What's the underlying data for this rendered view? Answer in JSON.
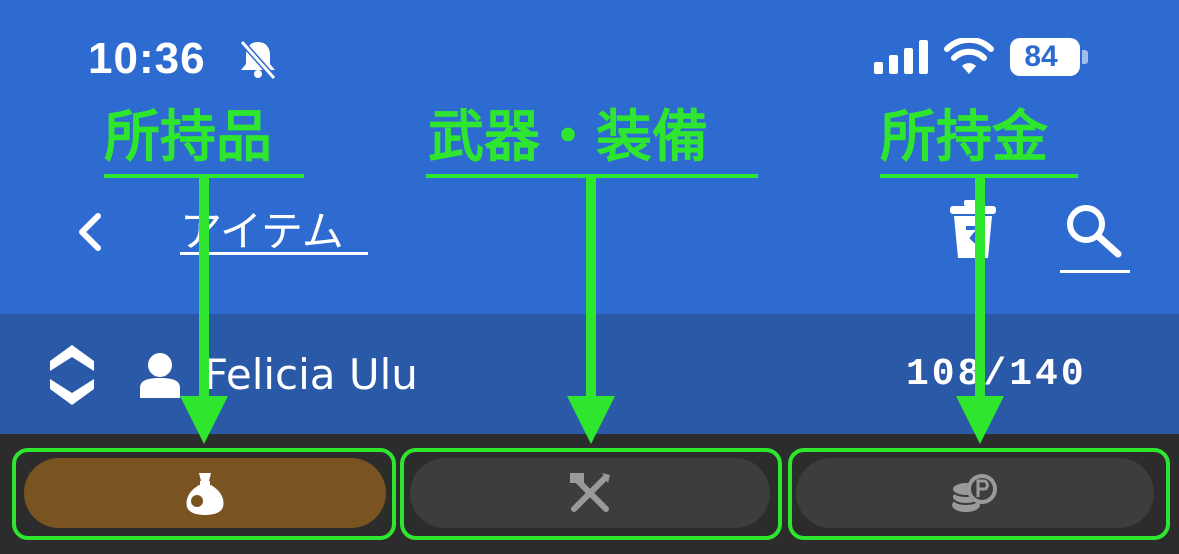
{
  "status_bar": {
    "time": "10:36",
    "battery": "84",
    "icons": [
      "bell-slash-icon",
      "cellular-signal-icon",
      "wifi-icon",
      "battery-icon"
    ]
  },
  "annotations": {
    "items_label": "所持品",
    "equipment_label": "武器・装備",
    "money_label": "所持金",
    "color": "#2ee62e"
  },
  "nav": {
    "title": "アイテム",
    "icons": [
      "chevron-left-icon",
      "trash-icon",
      "search-icon"
    ]
  },
  "user": {
    "name": "Felicia Ulu",
    "capacity": "108/140",
    "icons": [
      "switch-character-icon",
      "person-icon"
    ]
  },
  "tabs": [
    {
      "icon": "item-bag-icon",
      "active": true
    },
    {
      "icon": "weapons-crossed-icon",
      "active": false
    },
    {
      "icon": "coins-icon",
      "active": false
    }
  ],
  "colors": {
    "header_blue": "#2e6bd0",
    "user_bar_blue": "#2a59a8",
    "tab_bar": "#2c2c2c",
    "active_tab": "#7a5420",
    "inactive_tab": "#3d3d3d"
  }
}
